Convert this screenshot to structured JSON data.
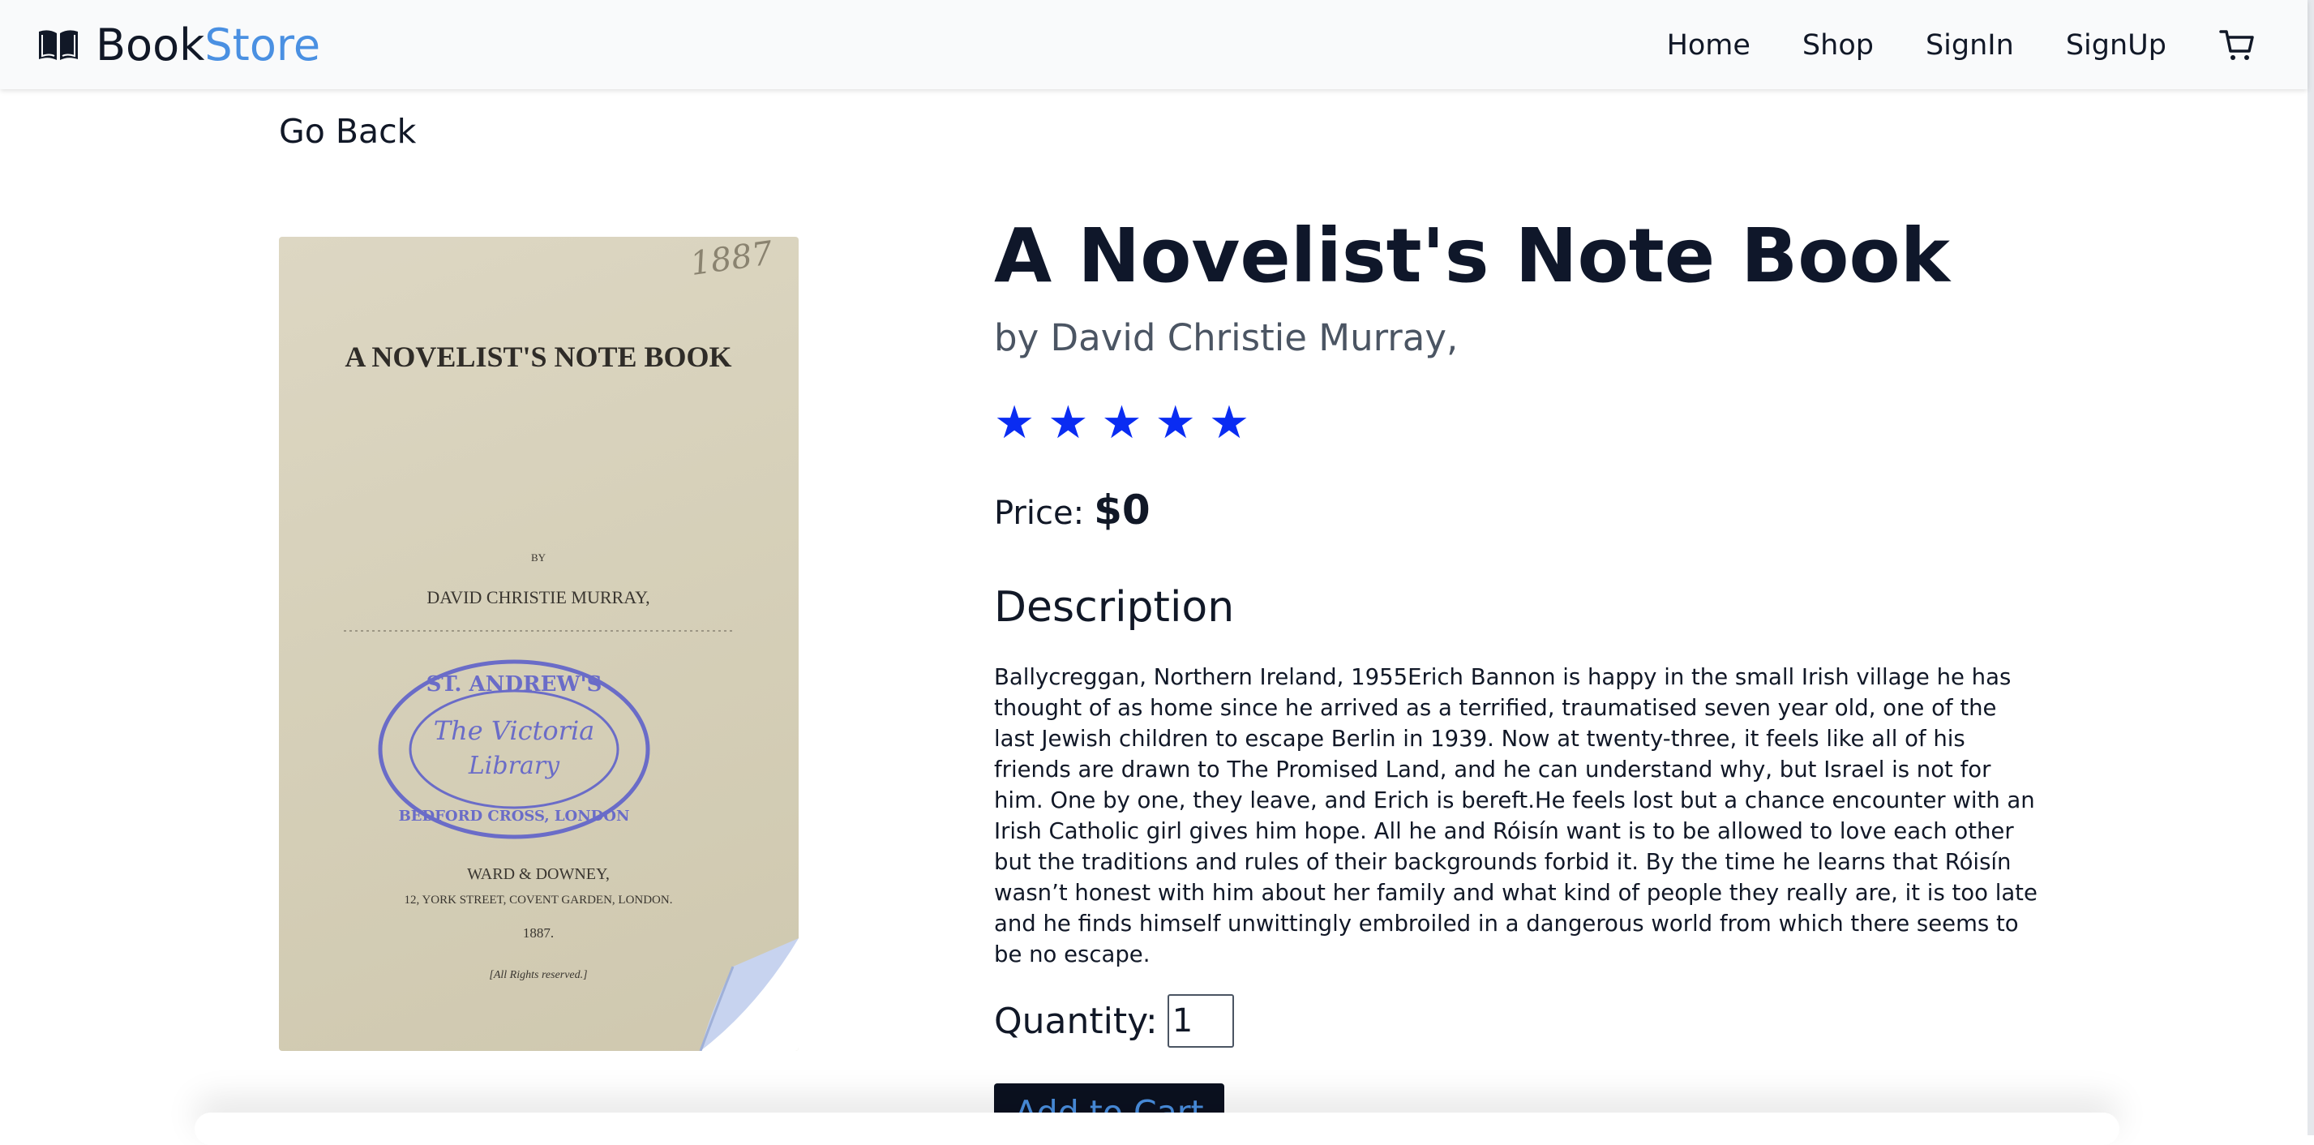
{
  "header": {
    "brand_primary": "Book",
    "brand_accent": "Store",
    "brand_icon": "open-book-icon",
    "nav": [
      "Home",
      "Shop",
      "SignIn",
      "SignUp"
    ],
    "cart_icon": "shopping-cart-icon"
  },
  "page": {
    "go_back": "Go Back"
  },
  "book": {
    "title": "A Novelist's Note Book",
    "author": "by David Christie Murray,",
    "rating": 5,
    "rating_max": 5,
    "price_label": "Price:",
    "price_value": "$0",
    "description_heading": "Description",
    "description": "Ballycreggan, Northern Ireland, 1955Erich Bannon is happy in the small Irish village he has thought of as home since he arrived as a terrified, traumatised seven year old, one of the last Jewish children to escape Berlin in 1939. Now at twenty-three, it feels like all of his friends are drawn to The Promised Land, and he can understand why, but Israel is not for him. One by one, they leave, and Erich is bereft.He feels lost but a chance encounter with an Irish Catholic girl gives him hope. All he and Róisín want is to be allowed to love each other but the traditions and rules of their backgrounds forbid it. By the time he learns that Róisín wasn’t honest with him about her family and what kind of people they really are, it is too late and he finds himself unwittingly embroiled in a dangerous world from which there seems to be no escape.",
    "quantity_label": "Quantity:",
    "quantity_value": "1",
    "add_to_cart": "Add to Cart",
    "cover": {
      "title": "A NOVELIST'S NOTE BOOK",
      "by": "BY",
      "author": "DAVID CHRISTIE MURRAY,",
      "stamp_line1": "ST. ANDREW'S",
      "stamp_line2": "The Victoria",
      "stamp_line3": "Library",
      "stamp_line4": "BEDFORD CROSS, LONDON",
      "publisher": "WARD & DOWNEY,",
      "address": "12, YORK STREET, COVENT GARDEN, LONDON.",
      "year": "1887.",
      "rights": "[All Rights reserved.]",
      "handwritten": "1887"
    }
  },
  "colors": {
    "accent": "#4a90e2",
    "star": "#0a2cf2",
    "button_bg": "#0b1120",
    "stamp": "#6a6cc8"
  }
}
